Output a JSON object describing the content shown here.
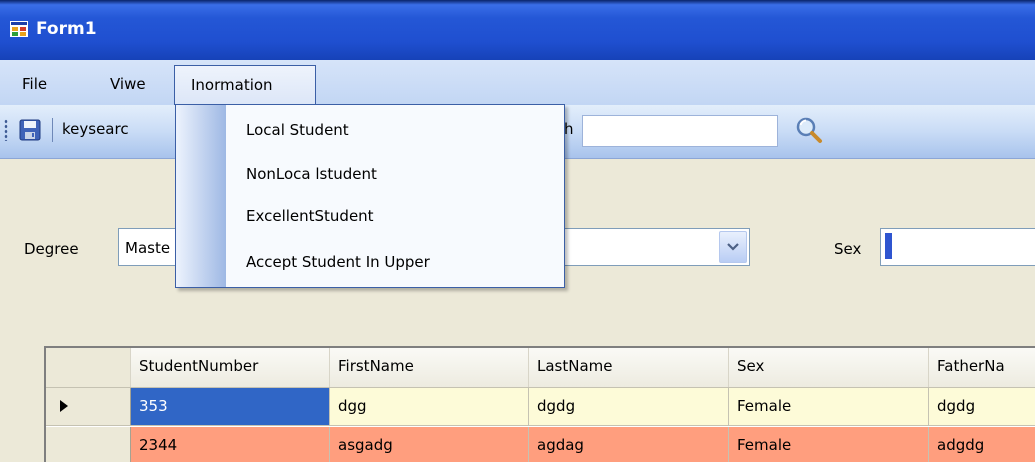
{
  "window": {
    "title": "Form1",
    "icon": "form-app-icon"
  },
  "menubar": {
    "items": [
      {
        "label": "File"
      },
      {
        "label": "Viwe"
      },
      {
        "label": "Inormation"
      }
    ]
  },
  "dropdown": {
    "items": [
      {
        "label": "Local Student"
      },
      {
        "label": "NonLoca lstudent"
      },
      {
        "label": "ExcellentStudent"
      },
      {
        "label": "Accept Student In Upper"
      }
    ]
  },
  "toolbar": {
    "save_icon": "save-icon",
    "label_left": "keysearc",
    "label_right": "h",
    "search_value": "",
    "search_icon": "magnifier-icon"
  },
  "form": {
    "degree_label": "Degree",
    "degree_value": "Maste",
    "sex_label": "Sex"
  },
  "grid": {
    "columns": [
      "StudentNumber",
      "FirstName",
      "LastName",
      "Sex",
      "FatherNa"
    ],
    "rows": [
      [
        "353",
        "dgg",
        "dgdg",
        "Female",
        "dgdg"
      ],
      [
        "2344",
        "asgadg",
        "agdag",
        "Female",
        "adgdg"
      ]
    ]
  },
  "colors": {
    "titlebar": "#2457D6",
    "selected_cell": "#3066C6",
    "row1_bg": "#FDFBD8",
    "row2_bg": "#FF9E7E"
  }
}
